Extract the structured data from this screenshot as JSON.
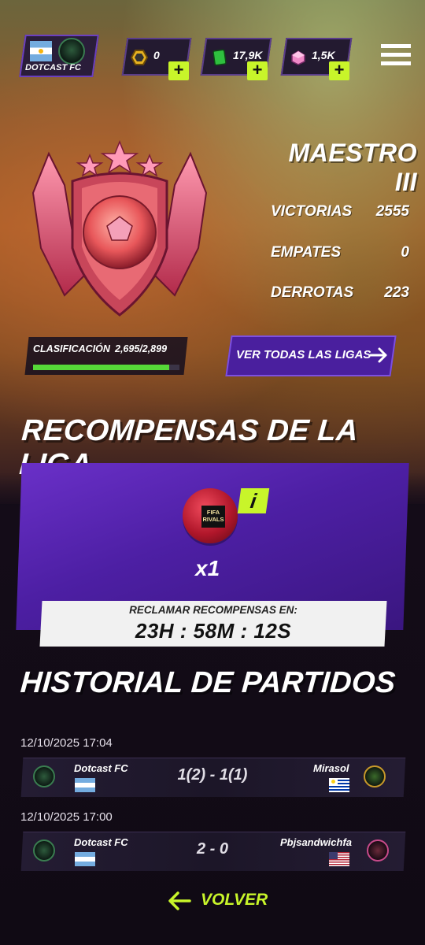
{
  "header": {
    "club_name": "DOTCAST FC",
    "currencies": [
      {
        "icon": "coin-icon",
        "value": "0"
      },
      {
        "icon": "green-gem-icon",
        "value": "17,9K"
      },
      {
        "icon": "pink-gem-icon",
        "value": "1,5K"
      }
    ],
    "plus_label": "+"
  },
  "rank": {
    "title": "MAESTRO III",
    "stats": [
      {
        "label": "VICTORIAS",
        "value": "2555"
      },
      {
        "label": "EMPATES",
        "value": "0"
      },
      {
        "label": "DERROTAS",
        "value": "223"
      }
    ],
    "classification_label": "CLASIFICACIÓN",
    "classification_value": "2,695/2,899",
    "classification_progress": 0.93
  },
  "leagues_button": {
    "label": "VER TODAS LAS LIGAS"
  },
  "rewards": {
    "title": "RECOMPENSAS DE LA LIGA",
    "ball_label_line1": "FIFA",
    "ball_label_line2": "RIVALS",
    "info_label": "i",
    "quantity": "x1",
    "claim_label": "RECLAMAR RECOMPENSAS EN:",
    "countdown": "23H : 58M : 12S"
  },
  "history": {
    "title": "HISTORIAL DE PARTIDOS",
    "matches": [
      {
        "date": "12/10/2025 17:04",
        "home": "Dotcast FC",
        "score": "1(2) - 1(1)",
        "away": "Mirasol"
      },
      {
        "date": "12/10/2025 17:00",
        "home": "Dotcast FC",
        "score": "2 - 0",
        "away": "Pbjsandwichfa"
      }
    ]
  },
  "footer": {
    "back_label": "VOLVER"
  },
  "colors": {
    "accent": "#c8f52a",
    "purple": "#4a1f9e",
    "progress": "#56d838"
  }
}
